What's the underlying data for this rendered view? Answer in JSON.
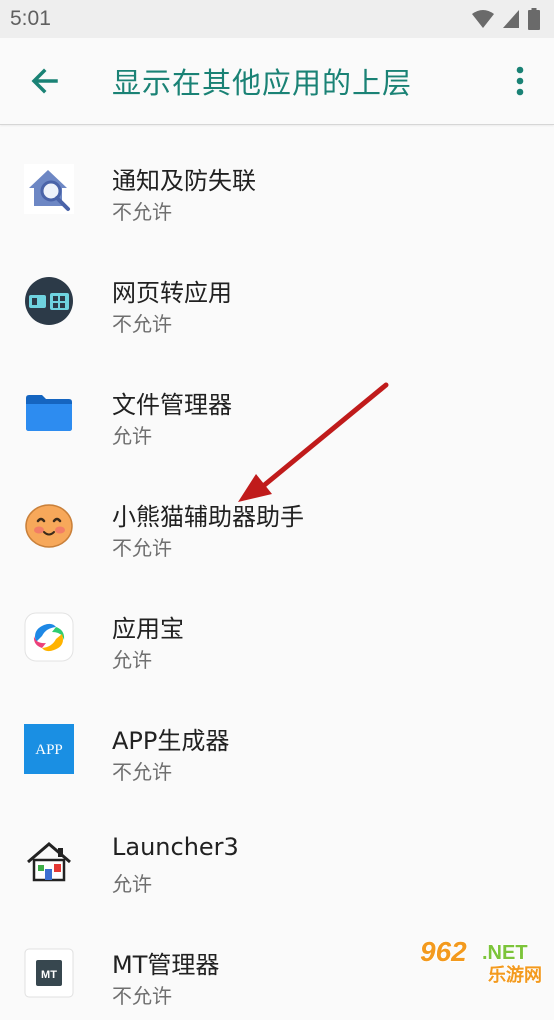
{
  "status_bar": {
    "time": "5:01"
  },
  "header": {
    "title": "显示在其他应用的上层"
  },
  "apps": [
    {
      "name": "通知及防失联",
      "status": "不允许",
      "icon": "house-search-icon"
    },
    {
      "name": "网页转应用",
      "status": "不允许",
      "icon": "web-to-app-icon"
    },
    {
      "name": "文件管理器",
      "status": "允许",
      "icon": "folder-icon"
    },
    {
      "name": "小熊猫辅助器助手",
      "status": "不允许",
      "icon": "smiley-face-icon"
    },
    {
      "name": "应用宝",
      "status": "允许",
      "icon": "yingyongbao-icon"
    },
    {
      "name": "APP生成器",
      "status": "不允许",
      "icon": "app-generator-icon",
      "icon_text": "APP"
    },
    {
      "name": "Launcher3",
      "status": "允许",
      "icon": "launcher-house-icon"
    },
    {
      "name": "MT管理器",
      "status": "不允许",
      "icon": "mt-manager-icon",
      "icon_text": "MT"
    }
  ],
  "watermark": {
    "text_a": "962",
    "text_b": ".NET",
    "text_c": "乐游网"
  },
  "colors": {
    "accent": "#1a8275",
    "annotation_arrow": "#d21f1f"
  }
}
